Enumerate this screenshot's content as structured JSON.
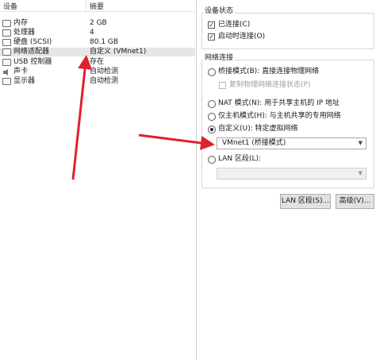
{
  "devices": {
    "header": {
      "device": "设备",
      "summary": "摘要"
    },
    "rows": [
      {
        "name": "内存",
        "summary": "2 GB",
        "icon": "memory-icon"
      },
      {
        "name": "处理器",
        "summary": "4",
        "icon": "processor-icon"
      },
      {
        "name": "硬盘 (SCSI)",
        "summary": "80.1 GB",
        "icon": "hard-disk-icon"
      },
      {
        "name": "网络适配器",
        "summary": "自定义 (VMnet1)",
        "icon": "network-adapter-icon"
      },
      {
        "name": "USB 控制器",
        "summary": "存在",
        "icon": "usb-controller-icon"
      },
      {
        "name": "声卡",
        "summary": "自动检测",
        "icon": "sound-card-icon"
      },
      {
        "name": "显示器",
        "summary": "自动检测",
        "icon": "display-icon"
      }
    ],
    "selected_index": 3
  },
  "device_status": {
    "title": "设备状态",
    "connected_label": "已连接(C)",
    "connected_checked": true,
    "connect_on_poweron_label": "启动时连接(O)",
    "connect_on_poweron_checked": true
  },
  "network_connection": {
    "title": "网络连接",
    "bridged_label": "桥接模式(B): 直接连接物理网络",
    "replicate_label": "复制物理网络连接状态(P)",
    "nat_label": "NAT 模式(N): 用于共享主机的 IP 地址",
    "hostonly_label": "仅主机模式(H): 与主机共享的专用网络",
    "custom_label": "自定义(U): 特定虚拟网络",
    "custom_value": "VMnet1 (桥接模式)",
    "lan_label": "LAN 区段(L):",
    "lan_value": "",
    "selected": "custom"
  },
  "buttons": {
    "lan_segments": "LAN 区段(S)...",
    "advanced": "高级(V)..."
  },
  "colors": {
    "annotation_arrow": "#e02030",
    "selected_row": "#e6e6e6"
  }
}
